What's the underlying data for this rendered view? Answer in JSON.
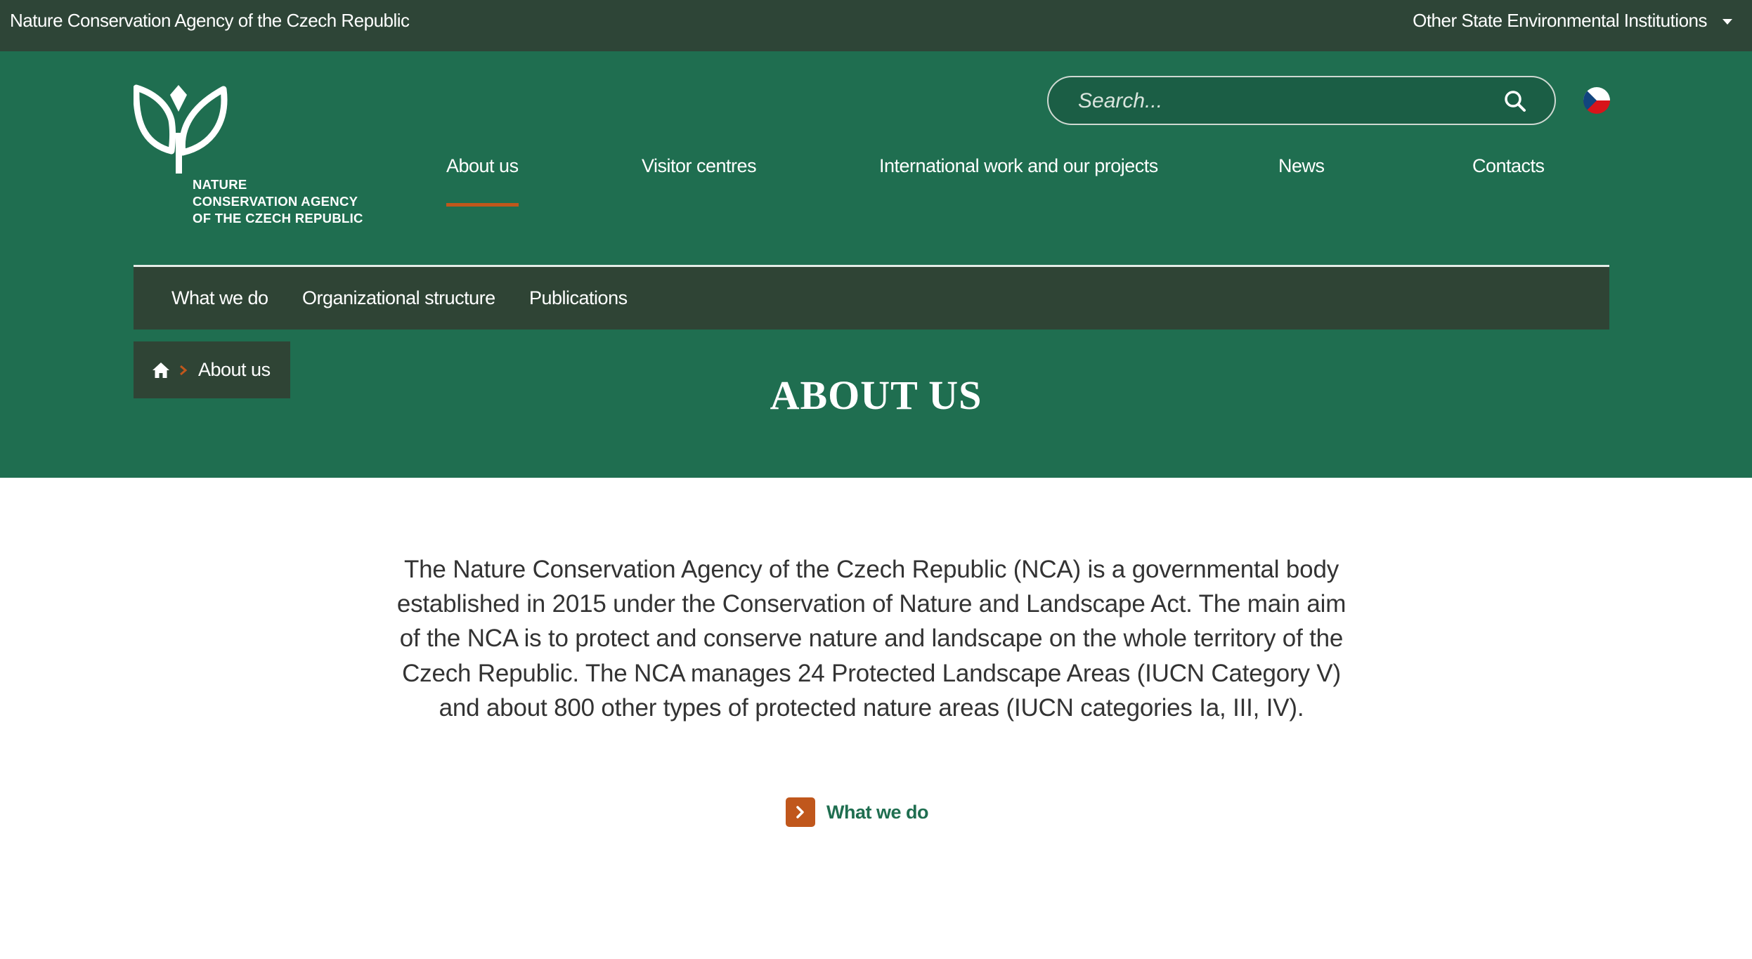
{
  "topbar": {
    "site_name": "Nature Conservation Agency of the Czech Republic",
    "other_institutions": "Other State Environmental Institutions"
  },
  "logo": {
    "lines": [
      "NATURE",
      "CONSERVATION AGENCY",
      "OF THE CZECH REPUBLIC"
    ]
  },
  "search": {
    "placeholder": "Search...",
    "icon": "search-icon"
  },
  "language": {
    "icon": "czech-flag-icon"
  },
  "main_nav": {
    "items": [
      {
        "label": "About us",
        "active": true
      },
      {
        "label": "Visitor centres",
        "active": false
      },
      {
        "label": "International work and our projects",
        "active": false
      },
      {
        "label": "News",
        "active": false
      },
      {
        "label": "Contacts",
        "active": false
      }
    ]
  },
  "sub_nav": {
    "items": [
      {
        "label": "What we do"
      },
      {
        "label": "Organizational structure"
      },
      {
        "label": "Publications"
      }
    ]
  },
  "breadcrumb": {
    "home_icon": "home-icon",
    "current": "About us"
  },
  "page": {
    "title": "ABOUT US",
    "intro": "The Nature Conservation Agency of the Czech Republic (NCA) is a governmental body established in 2015 under the Conservation of Nature and Landscape Act. The main aim of the NCA is to protect and conserve nature and landscape on the whole territory of the Czech Republic. The NCA manages 24 Protected Landscape Areas (IUCN Category V) and about 800 other types of protected nature areas (IUCN categories Ia, III, IV).",
    "link_label": "What we do"
  },
  "colors": {
    "topbar": "#2e4537",
    "header_green": "#1f6e50",
    "subnav": "#2f4435",
    "accent_orange": "#c0571c",
    "body_text": "#333333"
  }
}
